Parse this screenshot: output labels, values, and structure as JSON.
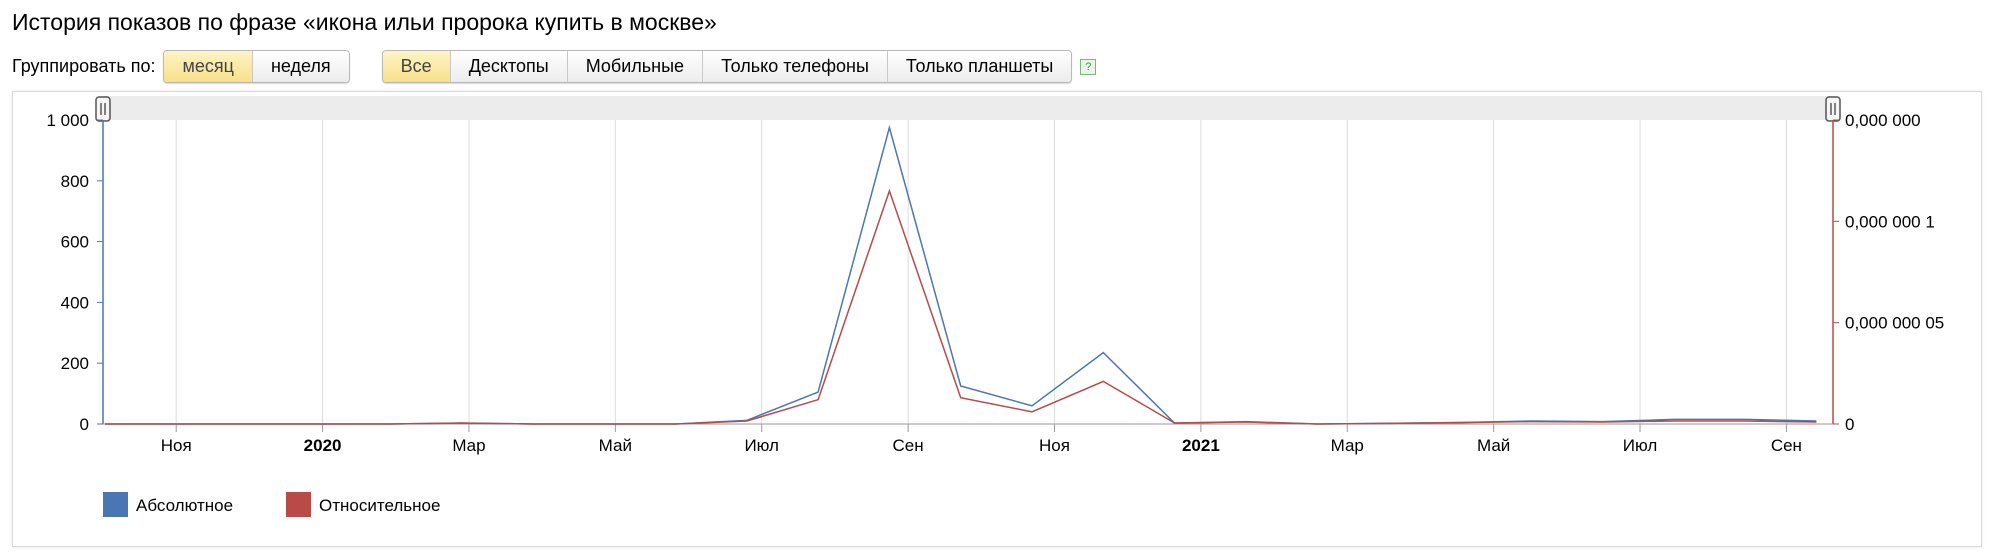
{
  "title": "История показов по фразе «икона ильи пророка купить в москве»",
  "group_by": {
    "label": "Группировать по:",
    "options": [
      {
        "label": "месяц",
        "active": true
      },
      {
        "label": "неделя",
        "active": false
      }
    ]
  },
  "device_filter": {
    "options": [
      {
        "label": "Все",
        "active": true
      },
      {
        "label": "Десктопы",
        "active": false
      },
      {
        "label": "Мобильные",
        "active": false
      },
      {
        "label": "Только телефоны",
        "active": false
      },
      {
        "label": "Только планшеты",
        "active": false
      }
    ],
    "help": "?"
  },
  "colors": {
    "absolute": "#4a77b4",
    "relative": "#b94a48"
  },
  "chart_data": {
    "type": "line",
    "title": "",
    "x": [
      "2019-10",
      "2019-11",
      "2019-12",
      "2020-01",
      "2020-02",
      "2020-03",
      "2020-04",
      "2020-05",
      "2020-06",
      "2020-07",
      "2020-08",
      "2020-09",
      "2020-10",
      "2020-11",
      "2020-12",
      "2021-01",
      "2021-02",
      "2021-03",
      "2021-04",
      "2021-05",
      "2021-06",
      "2021-07",
      "2021-08",
      "2021-09"
    ],
    "x_tick_labels": [
      {
        "label": "Ноя",
        "bold": false
      },
      {
        "label": "2020",
        "bold": true
      },
      {
        "label": "Мар",
        "bold": false
      },
      {
        "label": "Май",
        "bold": false
      },
      {
        "label": "Июл",
        "bold": false
      },
      {
        "label": "Сен",
        "bold": false
      },
      {
        "label": "Ноя",
        "bold": false
      },
      {
        "label": "2021",
        "bold": true
      },
      {
        "label": "Мар",
        "bold": false
      },
      {
        "label": "Май",
        "bold": false
      },
      {
        "label": "Июл",
        "bold": false
      },
      {
        "label": "Сен",
        "bold": false
      }
    ],
    "y_left": {
      "ticks": [
        "0",
        "200",
        "400",
        "600",
        "800",
        "1 000"
      ],
      "range": [
        0,
        1000
      ]
    },
    "y_right": {
      "ticks": [
        "0",
        "0,000 000 05",
        "0,000 000 1",
        "0,000 000"
      ],
      "range": [
        0,
        1.5e-07
      ]
    },
    "series": [
      {
        "name": "Абсолютное",
        "axis": "left",
        "values": [
          0,
          0,
          0,
          0,
          0,
          3,
          0,
          0,
          0,
          12,
          105,
          975,
          125,
          60,
          235,
          3,
          8,
          0,
          2,
          5,
          10,
          8,
          15,
          15,
          10
        ]
      },
      {
        "name": "Относительное",
        "axis": "right",
        "values": [
          0,
          0,
          0,
          0,
          0,
          5e-10,
          0,
          0,
          0,
          1.5e-09,
          1.2e-08,
          1.15e-07,
          1.3e-08,
          6e-09,
          2.1e-08,
          5e-10,
          1e-09,
          0,
          3e-10,
          7e-10,
          1.2e-09,
          1e-09,
          1.5e-09,
          1.5e-09,
          1e-09
        ]
      }
    ],
    "grid": true,
    "legend": "bottom-left"
  }
}
